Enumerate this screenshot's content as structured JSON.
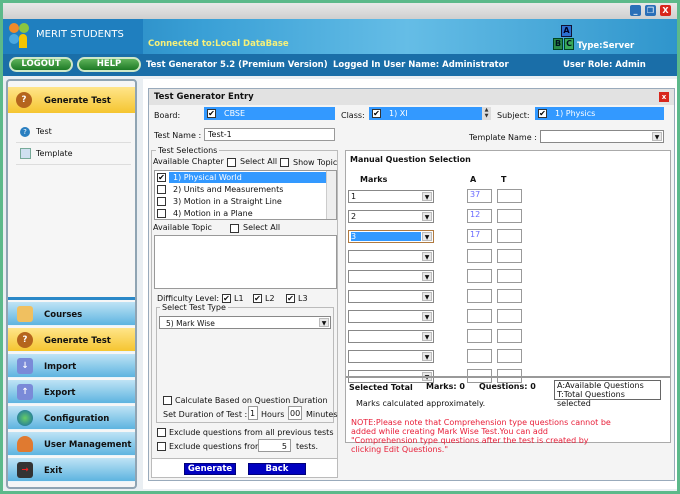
{
  "window": {
    "minimize": "_",
    "restore": "❐",
    "close": "X"
  },
  "header": {
    "app_name": "MERIT STUDENTS",
    "connection": "Connected to:Local DataBase",
    "type": "Type:Server",
    "blocks": [
      "A",
      "B",
      "C"
    ]
  },
  "nav": {
    "logout": "LOGOUT",
    "help": "HELP",
    "version": "Test Generator 5.2 (Premium Version)",
    "user": "Logged In User Name:  Administrator",
    "role": "User Role: Admin"
  },
  "sidebar": {
    "panel_title": "Generate Test",
    "sub_items": [
      {
        "label": "Test",
        "icon": "help-icon"
      },
      {
        "label": "Template",
        "icon": "template-icon"
      }
    ],
    "items": [
      {
        "label": "Courses",
        "icon": "clipboard-icon"
      },
      {
        "label": "Generate Test",
        "icon": "question-icon",
        "active": true
      },
      {
        "label": "Import",
        "icon": "import-icon"
      },
      {
        "label": "Export",
        "icon": "export-icon"
      },
      {
        "label": "Configuration",
        "icon": "globe-icon"
      },
      {
        "label": "User Management",
        "icon": "users-icon"
      },
      {
        "label": "Exit",
        "icon": "exit-icon"
      }
    ]
  },
  "dialog": {
    "title": "Test Generator Entry",
    "close": "x",
    "board_label": "Board:",
    "board_value": "CBSE",
    "class_label": "Class:",
    "class_value": "1) XI",
    "subject_label": "Subject:",
    "subject_value": "1) Physics",
    "test_name_label": "Test Name :",
    "test_name_value": "Test-1",
    "template_label": "Template Name :",
    "template_value": "",
    "test_selections": "Test Selections",
    "available_chapter": "Available Chapter",
    "select_all": "Select All",
    "show_topic": "Show Topic",
    "chapters": [
      {
        "label": "1) Physical World",
        "checked": true
      },
      {
        "label": "2) Units and Measurements",
        "checked": false
      },
      {
        "label": "3) Motion in a Straight Line",
        "checked": false
      },
      {
        "label": "4) Motion in a Plane",
        "checked": false
      }
    ],
    "available_topic": "Available Topic",
    "topic_select_all": "Select All",
    "difficulty_label": "Difficulty Level:",
    "levels": [
      "L1",
      "L2",
      "L3"
    ],
    "test_type_label": "Select Test Type",
    "test_type_value": "5) Mark Wise",
    "calc_duration": "Calculate Based on Question Duration",
    "duration_label": "Set Duration of Test :",
    "hours_value": "1",
    "hours": "Hours",
    "minutes_value": "00",
    "minutes": "Minutes",
    "exclude_all": "Exclude questions from all previous tests",
    "exclude_from": "Exclude questions from",
    "exclude_count": "5",
    "tests": "tests.",
    "generate": "Generate",
    "back": "Back",
    "manual_title": "Manual Question Selection",
    "col_marks": "Marks",
    "col_a": "A",
    "col_t": "T",
    "rows": [
      {
        "marks": "1",
        "a": "37",
        "t": ""
      },
      {
        "marks": "2",
        "a": "12",
        "t": ""
      },
      {
        "marks": "3",
        "a": "17",
        "t": ""
      },
      {
        "marks": "",
        "a": "",
        "t": ""
      },
      {
        "marks": "",
        "a": "",
        "t": ""
      },
      {
        "marks": "",
        "a": "",
        "t": ""
      },
      {
        "marks": "",
        "a": "",
        "t": ""
      },
      {
        "marks": "",
        "a": "",
        "t": ""
      },
      {
        "marks": "",
        "a": "",
        "t": ""
      },
      {
        "marks": "",
        "a": "",
        "t": ""
      }
    ],
    "selected_total": "Selected Total",
    "marks_total": "Marks: 0",
    "questions_total": "Questions: 0",
    "legend_a": "A:Available Questions",
    "legend_t": "T:Total Questions selected",
    "approx": "Marks calculated approximately.",
    "note": "NOTE:Please note that Comprehension type questions cannot be added while creating Mark Wise Test.You can add \"Comprehension type questions after the test is created by clicking Edit Questions.\""
  }
}
